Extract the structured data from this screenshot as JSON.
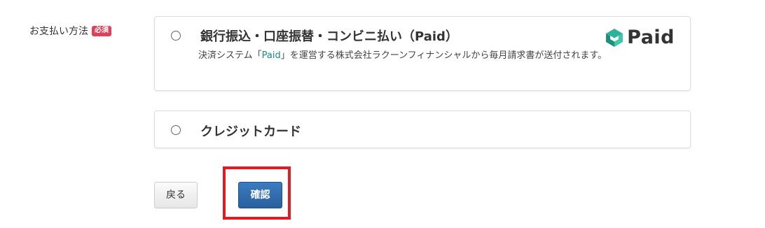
{
  "field": {
    "label": "お支払い方法",
    "required_badge": "必須"
  },
  "options": {
    "paid": {
      "title": "銀行振込・口座振替・コンビニ払い（Paid）",
      "desc_before": "決済システム「",
      "desc_link": "Paid",
      "desc_after": "」を運営する株式会社ラクーンフィナンシャルから毎月請求書が送付されます。",
      "logo_text": "Paid",
      "logo_icon": "paid-logo-icon"
    },
    "credit": {
      "title": "クレジットカード"
    }
  },
  "actions": {
    "back_label": "戻る",
    "confirm_label": "確認"
  },
  "colors": {
    "required_badge": "#e0405a",
    "paid_link": "#1a8a87",
    "confirm_button": "#2f6aab",
    "highlight": "#e01b22"
  }
}
